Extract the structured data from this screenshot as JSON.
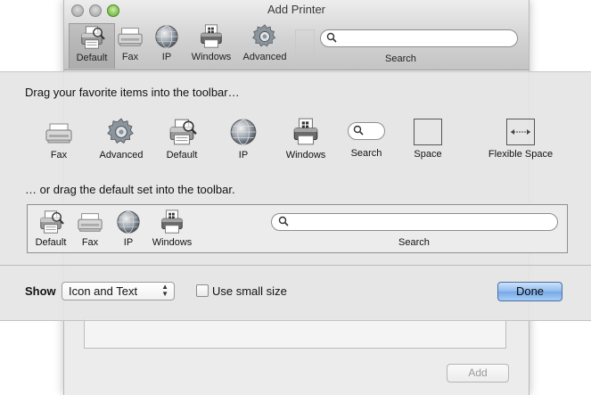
{
  "window": {
    "title": "Add Printer",
    "toolbar": [
      {
        "label": "Default",
        "icon": "default-printer-icon"
      },
      {
        "label": "Fax",
        "icon": "fax-icon"
      },
      {
        "label": "IP",
        "icon": "globe-icon"
      },
      {
        "label": "Windows",
        "icon": "windows-printer-icon"
      },
      {
        "label": "Advanced",
        "icon": "gear-icon"
      }
    ],
    "search_label": "Search",
    "add_button": "Add"
  },
  "sheet": {
    "palette_heading": "Drag your favorite items into the toolbar…",
    "palette": [
      {
        "label": "Fax",
        "icon": "fax-icon"
      },
      {
        "label": "Advanced",
        "icon": "gear-icon"
      },
      {
        "label": "Default",
        "icon": "default-printer-icon"
      },
      {
        "label": "IP",
        "icon": "globe-icon"
      },
      {
        "label": "Windows",
        "icon": "windows-printer-icon"
      },
      {
        "label": "Search",
        "icon": "search-field-icon"
      },
      {
        "label": "Space",
        "icon": "space-icon"
      },
      {
        "label": "Flexible Space",
        "icon": "flexible-space-icon"
      }
    ],
    "default_heading": "… or drag the default set into the toolbar.",
    "default_set": [
      {
        "label": "Default",
        "icon": "default-printer-icon"
      },
      {
        "label": "Fax",
        "icon": "fax-icon"
      },
      {
        "label": "IP",
        "icon": "globe-icon"
      },
      {
        "label": "Windows",
        "icon": "windows-printer-icon"
      }
    ],
    "default_search_label": "Search",
    "show_label": "Show",
    "show_value": "Icon and Text",
    "small_size_label": "Use small size",
    "small_size_checked": false,
    "done_label": "Done"
  }
}
